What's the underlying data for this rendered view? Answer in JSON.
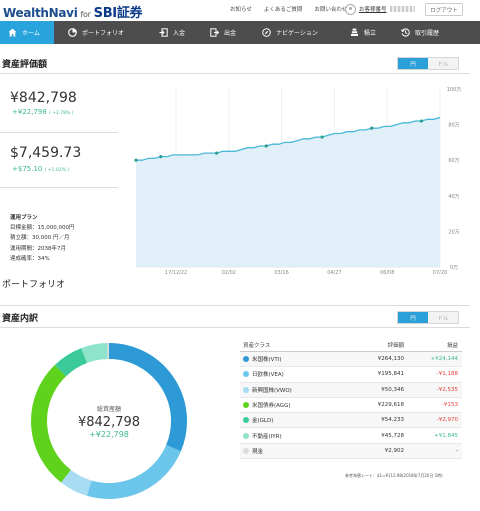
{
  "header": {
    "logo_main": "WealthNavi",
    "logo_for": "for",
    "logo_partner": "SBI証券",
    "links": [
      "お知らせ",
      "よくあるご質問",
      "お問い合わせ"
    ],
    "user_label": "お客様番号",
    "logout": "ログアウト"
  },
  "nav": [
    {
      "label": "ホーム",
      "icon": "home-icon",
      "active": true
    },
    {
      "label": "ポートフォリオ",
      "icon": "pie-chart-icon",
      "active": false
    },
    {
      "label": "入金",
      "icon": "deposit-icon",
      "active": false
    },
    {
      "label": "出金",
      "icon": "withdraw-icon",
      "active": false
    },
    {
      "label": "ナビゲーション",
      "icon": "compass-icon",
      "active": false
    },
    {
      "label": "積立",
      "icon": "stack-icon",
      "active": false
    },
    {
      "label": "取引履歴",
      "icon": "history-icon",
      "active": false
    }
  ],
  "valuation": {
    "title": "資産評価額",
    "toggle_yen": "円",
    "toggle_usd": "ドル",
    "jpy_total": "¥842,798",
    "jpy_gain": "+¥22,798",
    "jpy_gain_pct": "( +2.78% )",
    "usd_total": "$7,459.73",
    "usd_gain": "+$75.10",
    "usd_gain_pct": "( +1.02% )"
  },
  "plan": {
    "title": "運用プラン",
    "target": "目標金額：15,000,000円",
    "monthly": "積立額：30,000 円／月",
    "period": "運用期間：2038年7月",
    "achievement": "達成確率：34%"
  },
  "portfolio_label": "ポートフォリオ",
  "chart_data": {
    "type": "area",
    "x_ticks": [
      "17/12/22",
      "02/02",
      "03/16",
      "04/27",
      "06/08",
      "07/20"
    ],
    "y_ticks": [
      "100万",
      "80万",
      "60万",
      "40万",
      "20万",
      "0万"
    ],
    "ylim": [
      0,
      100
    ],
    "ylabel_unit": "万",
    "series": [
      {
        "values": [
          60,
          60,
          61,
          61,
          62,
          62,
          63,
          63,
          63,
          63,
          63,
          64,
          64,
          64,
          65,
          65,
          65,
          66,
          67,
          67,
          68,
          68,
          69,
          69,
          70,
          70,
          71,
          72,
          72,
          73,
          73,
          74,
          75,
          75,
          76,
          76,
          77,
          77,
          78,
          78,
          79,
          79,
          80,
          81,
          81,
          82,
          82,
          83,
          83,
          84
        ]
      }
    ],
    "deposit_markers": [
      0,
      4,
      13,
      21,
      30,
      38,
      46
    ],
    "colors": {
      "line": "#4ab8d8",
      "fill": "#dcedf7",
      "marker": "#2a9d8f"
    }
  },
  "breakdown": {
    "title": "資産内訳",
    "toggle_yen": "円",
    "toggle_usd": "ドル",
    "center_label": "総資産額",
    "center_total": "¥842,798",
    "center_gain": "+¥22,798",
    "headers": {
      "asset": "資産クラス",
      "value": "評価額",
      "pl": "損益"
    },
    "rows": [
      {
        "name": "米国株(VTI)",
        "value": "¥264,130",
        "pl": "+¥24,144",
        "pl_sign": "pos",
        "color": "#2d9ad6"
      },
      {
        "name": "日欧株(VEA)",
        "value": "¥195,841",
        "pl": "-¥1,188",
        "pl_sign": "neg",
        "color": "#6cc6ec"
      },
      {
        "name": "新興国株(VWO)",
        "value": "¥50,346",
        "pl": "-¥2,535",
        "pl_sign": "neg",
        "color": "#a8dcf3"
      },
      {
        "name": "米国債券(AGG)",
        "value": "¥229,618",
        "pl": "-¥153",
        "pl_sign": "neg",
        "color": "#5fd21c"
      },
      {
        "name": "金(GLD)",
        "value": "¥54,233",
        "pl": "-¥2,970",
        "pl_sign": "neg",
        "color": "#3bcb9a"
      },
      {
        "name": "不動産(IYR)",
        "value": "¥45,728",
        "pl": "+¥1,845",
        "pl_sign": "pos",
        "color": "#8ee3cb"
      },
      {
        "name": "現金",
        "value": "¥2,902",
        "pl": "-",
        "pl_sign": "none",
        "color": "#dddddd"
      }
    ],
    "note": "参考為替レート：$1=¥112.98(2018年7月20日 1時)"
  }
}
